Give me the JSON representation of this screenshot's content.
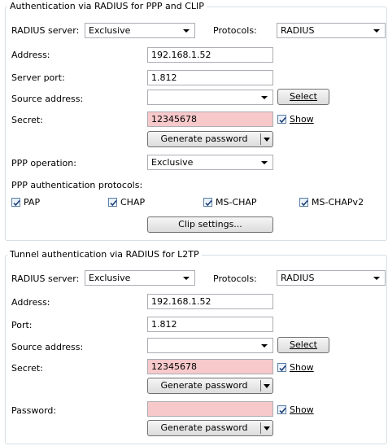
{
  "radius_ppp": {
    "legend": "Authentication via RADIUS for PPP and CLIP",
    "server_label": "RADIUS server:",
    "server_value": "Exclusive",
    "protocols_label": "Protocols:",
    "protocols_value": "RADIUS",
    "address_label": "Address:",
    "address_value": "192.168.1.52",
    "port_label": "Server port:",
    "port_value": "1.812",
    "source_label": "Source address:",
    "source_value": "",
    "select_btn": "Select",
    "secret_label": "Secret:",
    "secret_value": "12345678",
    "show_label": "Show",
    "show_checked": true,
    "gen_password": "Generate password",
    "ppp_op_label": "PPP operation:",
    "ppp_op_value": "Exclusive",
    "ppp_auth_label": "PPP authentication protocols:",
    "auth_protocols": [
      {
        "label": "PAP",
        "checked": true
      },
      {
        "label": "CHAP",
        "checked": true
      },
      {
        "label": "MS-CHAP",
        "checked": true
      },
      {
        "label": "MS-CHAPv2",
        "checked": true
      }
    ],
    "clip_btn": "Clip settings..."
  },
  "radius_l2tp": {
    "legend": "Tunnel authentication via RADIUS for L2TP",
    "server_label": "RADIUS server:",
    "server_value": "Exclusive",
    "protocols_label": "Protocols:",
    "protocols_value": "RADIUS",
    "address_label": "Address:",
    "address_value": "192.168.1.52",
    "port_label": "Port:",
    "port_value": "1.812",
    "source_label": "Source address:",
    "source_value": "",
    "select_btn": "Select",
    "secret_label": "Secret:",
    "secret_value": "12345678",
    "show_label": "Show",
    "show_checked": true,
    "gen_password": "Generate password",
    "password_label": "Password:",
    "password_value": "",
    "password_show_label": "Show",
    "password_show_checked": true,
    "gen_password2": "Generate password"
  },
  "colors": {
    "group_border": "#d5dfe5",
    "field_border": "#abadb3",
    "invalid_field_bg": "#f7c9cb"
  }
}
